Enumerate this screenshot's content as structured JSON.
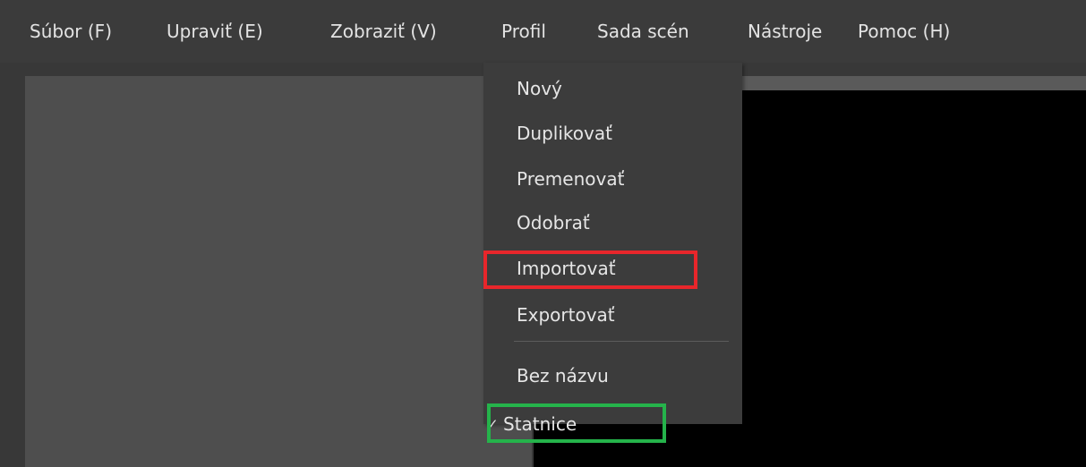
{
  "menubar": {
    "items": [
      {
        "label": "Súbor (F)"
      },
      {
        "label": "Upraviť (E)"
      },
      {
        "label": "Zobraziť (V)"
      },
      {
        "label": "Profil"
      },
      {
        "label": "Sada scén"
      },
      {
        "label": "Nástroje"
      },
      {
        "label": "Pomoc (H)"
      }
    ]
  },
  "profile_menu": {
    "items": [
      {
        "label": "Nový"
      },
      {
        "label": "Duplikovať"
      },
      {
        "label": "Premenovať"
      },
      {
        "label": "Odobrať"
      },
      {
        "label": "Importovať",
        "highlight": "red"
      },
      {
        "label": "Exportovať"
      }
    ],
    "profiles": [
      {
        "label": "Bez názvu",
        "checked": false
      },
      {
        "label": "Statnice",
        "checked": true,
        "highlight": "green"
      }
    ],
    "check_icon": "check-icon",
    "check_glyph": "✓"
  },
  "colors": {
    "background": "#383838",
    "panel": "#4e4e4e",
    "preview": "#000000",
    "menu": "#3c3c3c",
    "highlight_red": "#e8262b",
    "highlight_green": "#25b34b"
  }
}
